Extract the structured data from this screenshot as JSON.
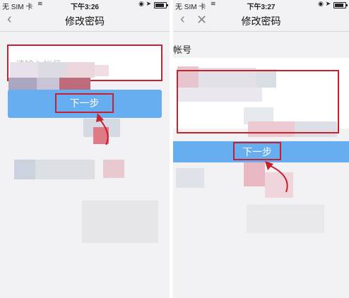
{
  "left_screen": {
    "status": {
      "carrier": "无 SIM 卡",
      "time": "下午3:26"
    },
    "title": "修改密码",
    "input_placeholder": "请输入帐号",
    "next_label": "下一步"
  },
  "right_screen": {
    "status": {
      "carrier": "无 SIM 卡",
      "time": "下午3:27"
    },
    "title": "修改密码",
    "field_label": "帐号",
    "next_label": "下一步"
  },
  "icons": {
    "back": "chevron-left",
    "close": "close-x",
    "wifi": "wifi",
    "location": "location-arrow",
    "battery": "battery"
  },
  "colors": {
    "highlight": "#c9202f",
    "button": "#67aef0",
    "screen_bg": "#f2f2f4"
  }
}
